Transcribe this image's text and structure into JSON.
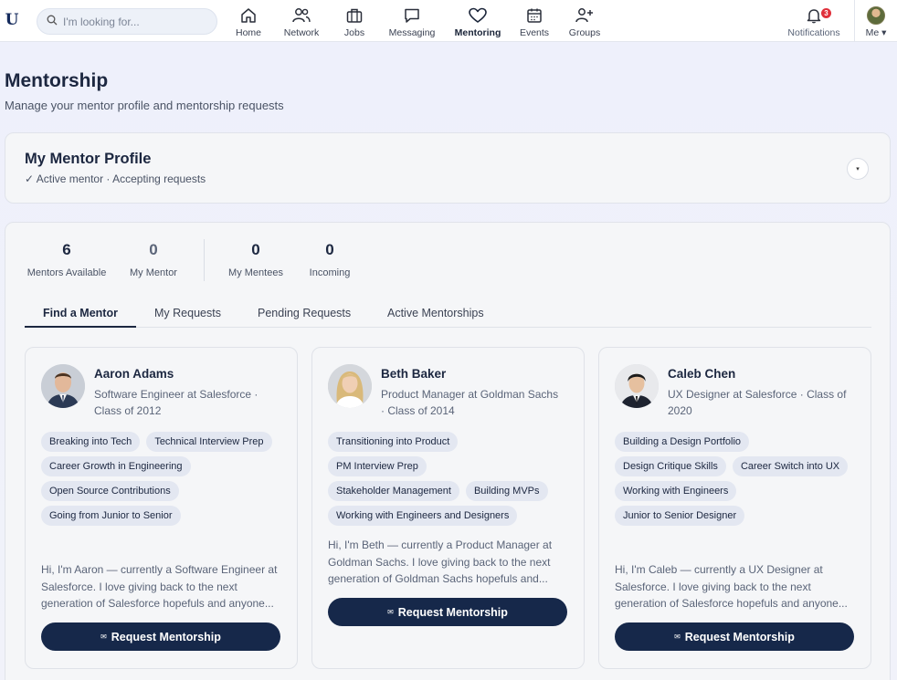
{
  "app": {
    "logo_letter": "U"
  },
  "search": {
    "placeholder": "I'm looking for..."
  },
  "nav": [
    {
      "label": "Home",
      "icon": "home-icon"
    },
    {
      "label": "Network",
      "icon": "people-icon"
    },
    {
      "label": "Jobs",
      "icon": "briefcase-icon"
    },
    {
      "label": "Messaging",
      "icon": "chat-icon"
    },
    {
      "label": "Mentoring",
      "icon": "heart-icon",
      "active": true
    },
    {
      "label": "Events",
      "icon": "calendar-icon"
    },
    {
      "label": "Groups",
      "icon": "add-group-icon"
    }
  ],
  "notifications": {
    "label": "Notifications",
    "count": "3"
  },
  "me": {
    "label": "Me ▾"
  },
  "page": {
    "title": "Mentorship",
    "subtitle": "Manage your mentor profile and mentorship requests"
  },
  "profile": {
    "title": "My Mentor Profile",
    "status": "✓ Active mentor · Accepting requests",
    "toggle": "▾"
  },
  "stats": [
    {
      "value": "6",
      "label": "Mentors Available"
    },
    {
      "value": "0",
      "label": "My Mentor"
    },
    {
      "value": "0",
      "label": "My Mentees"
    },
    {
      "value": "0",
      "label": "Incoming"
    }
  ],
  "tabs": [
    "Find a Mentor",
    "My Requests",
    "Pending Requests",
    "Active Mentorships"
  ],
  "mentors": [
    {
      "name": "Aaron Adams",
      "role": "Software Engineer at Salesforce · Class of 2012",
      "tags": [
        "Breaking into Tech",
        "Technical Interview Prep",
        "Career Growth in Engineering",
        "Open Source Contributions",
        "Going from Junior to Senior"
      ],
      "bio": "Hi, I'm Aaron — currently a Software Engineer at Salesforce. I love giving back to the next generation of Salesforce hopefuls and anyone...",
      "button": "Request Mentorship"
    },
    {
      "name": "Beth Baker",
      "role": "Product Manager at Goldman Sachs · Class of 2014",
      "tags": [
        "Transitioning into Product",
        "PM Interview Prep",
        "Stakeholder Management",
        "Building MVPs",
        "Working with Engineers and Designers"
      ],
      "bio": "Hi, I'm Beth — currently a Product Manager at Goldman Sachs. I love giving back to the next generation of Goldman Sachs hopefuls and...",
      "button": "Request Mentorship"
    },
    {
      "name": "Caleb Chen",
      "role": "UX Designer at Salesforce · Class of 2020",
      "tags": [
        "Building a Design Portfolio",
        "Design Critique Skills",
        "Career Switch into UX",
        "Working with Engineers",
        "Junior to Senior Designer"
      ],
      "bio": "Hi, I'm Caleb — currently a UX Designer at Salesforce. I love giving back to the next generation of Salesforce hopefuls and anyone...",
      "button": "Request Mentorship"
    }
  ],
  "colors": {
    "primary": "#16284a",
    "chip": "#e3e7f1",
    "badge": "#e0303b"
  }
}
